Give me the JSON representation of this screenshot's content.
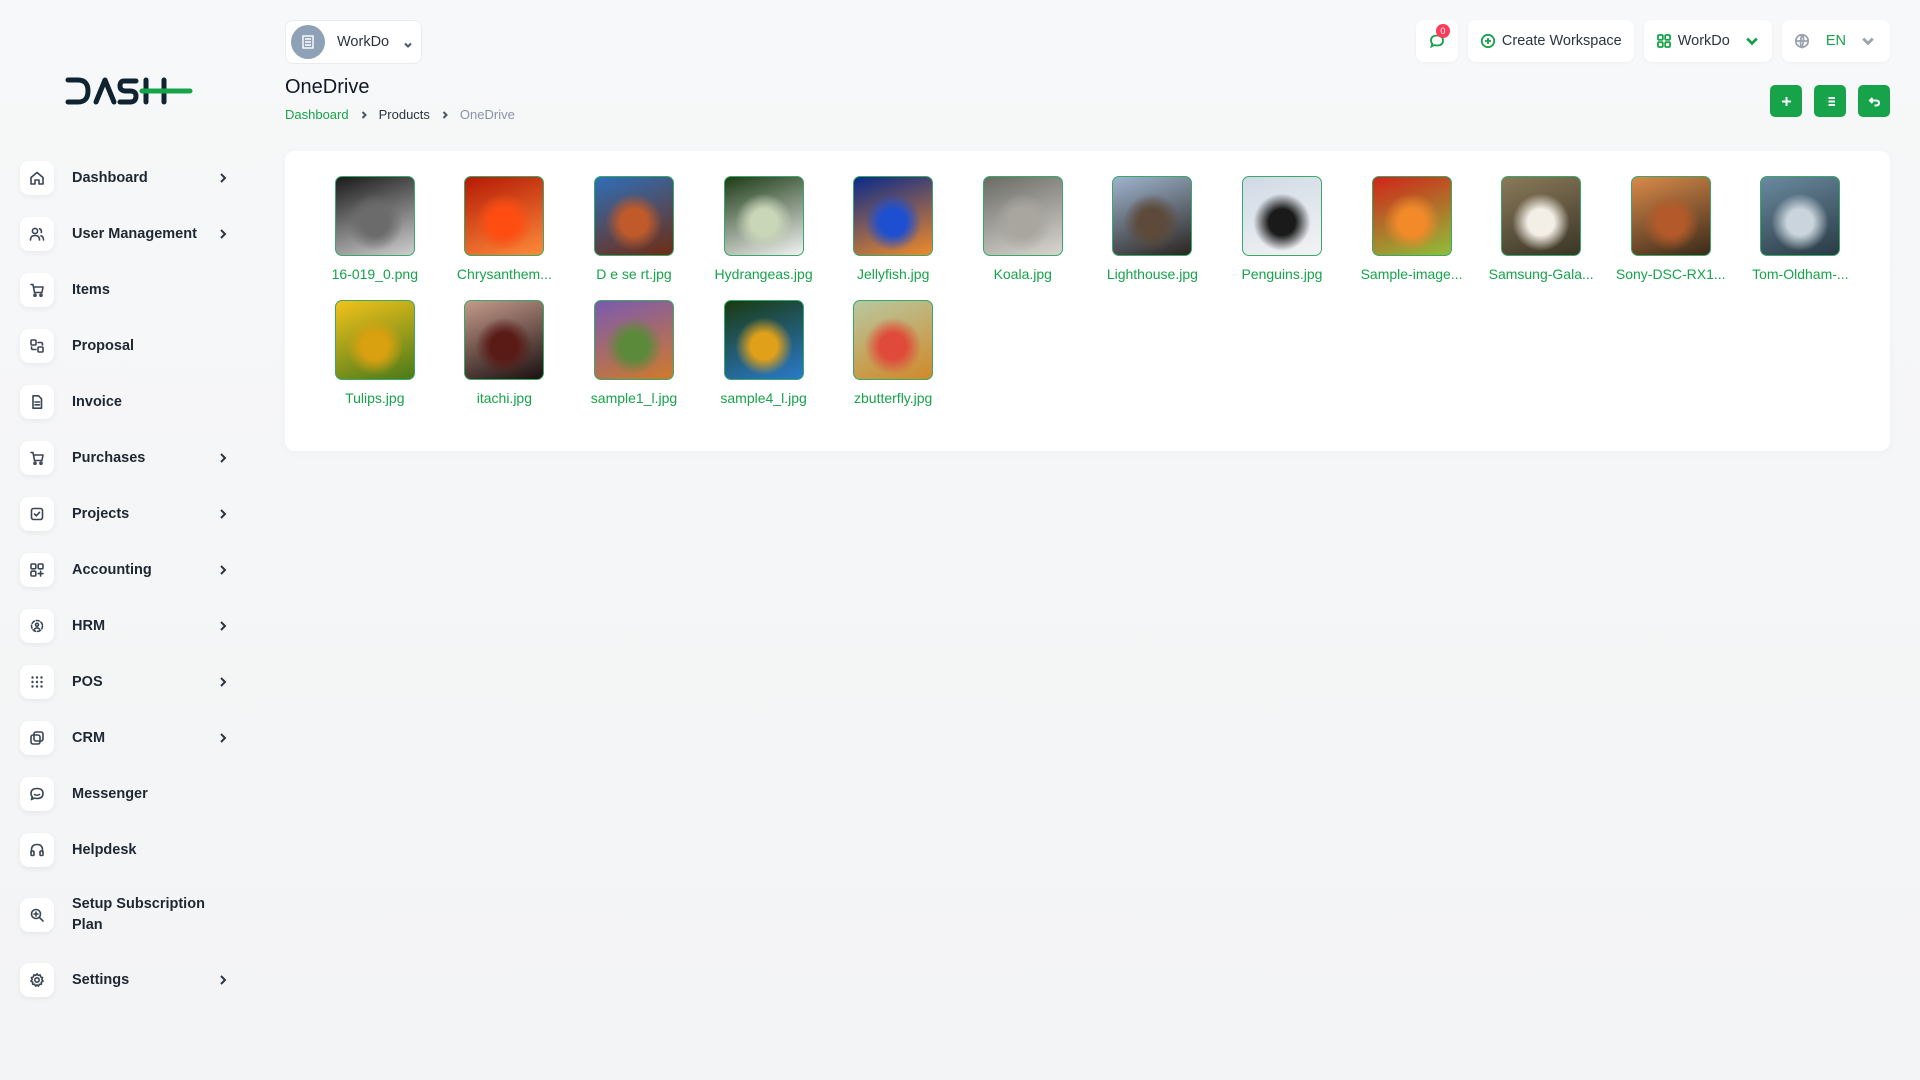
{
  "sidebar": {
    "items": [
      {
        "label": "Dashboard",
        "icon": "home-icon",
        "chevron": true
      },
      {
        "label": "User Management",
        "icon": "users-icon",
        "chevron": true
      },
      {
        "label": "Items",
        "icon": "cart-icon",
        "chevron": false
      },
      {
        "label": "Proposal",
        "icon": "proposal-icon",
        "chevron": false
      },
      {
        "label": "Invoice",
        "icon": "invoice-icon",
        "chevron": false
      },
      {
        "label": "Purchases",
        "icon": "cart-icon",
        "chevron": true
      },
      {
        "label": "Projects",
        "icon": "check-square-icon",
        "chevron": true
      },
      {
        "label": "Accounting",
        "icon": "grid-icon",
        "chevron": true
      },
      {
        "label": "HRM",
        "icon": "hrm-icon",
        "chevron": true
      },
      {
        "label": "POS",
        "icon": "dots-grid-icon",
        "chevron": true
      },
      {
        "label": "CRM",
        "icon": "layers-icon",
        "chevron": true
      },
      {
        "label": "Messenger",
        "icon": "chat-icon",
        "chevron": false
      },
      {
        "label": "Helpdesk",
        "icon": "headset-icon",
        "chevron": false
      },
      {
        "label": "Setup Subscription Plan",
        "icon": "search-plan-icon",
        "chevron": false
      },
      {
        "label": "Settings",
        "icon": "gear-icon",
        "chevron": true
      }
    ]
  },
  "topbar": {
    "workspace_name": "WorkDo",
    "message_count": "0",
    "create_workspace_label": "Create Workspace",
    "workspace_menu_label": "WorkDo",
    "language": "EN"
  },
  "page": {
    "title": "OneDrive",
    "breadcrumb": [
      "Dashboard",
      "Products",
      "OneDrive"
    ]
  },
  "files": [
    {
      "name": "16-019_0.png",
      "colors": [
        "#1a1a1a",
        "#6b6b6b",
        "#cfcfcf"
      ]
    },
    {
      "name": "Chrysanthem...",
      "colors": [
        "#b41a05",
        "#ff4d12",
        "#ff8a3a"
      ]
    },
    {
      "name": "D e se rt.jpg",
      "colors": [
        "#2f6fb8",
        "#c05a2a",
        "#6e2c12"
      ]
    },
    {
      "name": "Hydrangeas.jpg",
      "colors": [
        "#1d3b16",
        "#c9d6b8",
        "#f2f2f2"
      ]
    },
    {
      "name": "Jellyfish.jpg",
      "colors": [
        "#0a2a8a",
        "#1e4fd1",
        "#f08a2a"
      ]
    },
    {
      "name": "Koala.jpg",
      "colors": [
        "#6b6b66",
        "#a8a69e",
        "#d8d6cf"
      ]
    },
    {
      "name": "Lighthouse.jpg",
      "colors": [
        "#9fb4cf",
        "#5d4a3a",
        "#2a2520"
      ]
    },
    {
      "name": "Penguins.jpg",
      "colors": [
        "#cfd9e6",
        "#1a1a1a",
        "#f3f3f3"
      ]
    },
    {
      "name": "Sample-image...",
      "colors": [
        "#d1241a",
        "#f28a2a",
        "#8fbf3a"
      ]
    },
    {
      "name": "Samsung-Gala...",
      "colors": [
        "#8a7a5a",
        "#f3efe6",
        "#3a3526"
      ]
    },
    {
      "name": "Sony-DSC-RX1...",
      "colors": [
        "#d98a4a",
        "#b45a2a",
        "#3a2a1a"
      ]
    },
    {
      "name": "Tom-Oldham-...",
      "colors": [
        "#6a8aa0",
        "#c9d4dc",
        "#2a3a44"
      ]
    },
    {
      "name": "Tulips.jpg",
      "colors": [
        "#f2c21a",
        "#d9a010",
        "#4a7a1a"
      ]
    },
    {
      "name": "itachi.jpg",
      "colors": [
        "#c49a8a",
        "#5a1a16",
        "#1a1010"
      ]
    },
    {
      "name": "sample1_l.jpg",
      "colors": [
        "#7a5ab0",
        "#5a8a3a",
        "#d07a2a"
      ]
    },
    {
      "name": "sample4_l.jpg",
      "colors": [
        "#1a3a10",
        "#e0a01a",
        "#2a7acb"
      ]
    },
    {
      "name": "zbutterfly.jpg",
      "colors": [
        "#b8c8a0",
        "#e04a3a",
        "#d0892a"
      ]
    }
  ],
  "accent_color": "#16a34a"
}
